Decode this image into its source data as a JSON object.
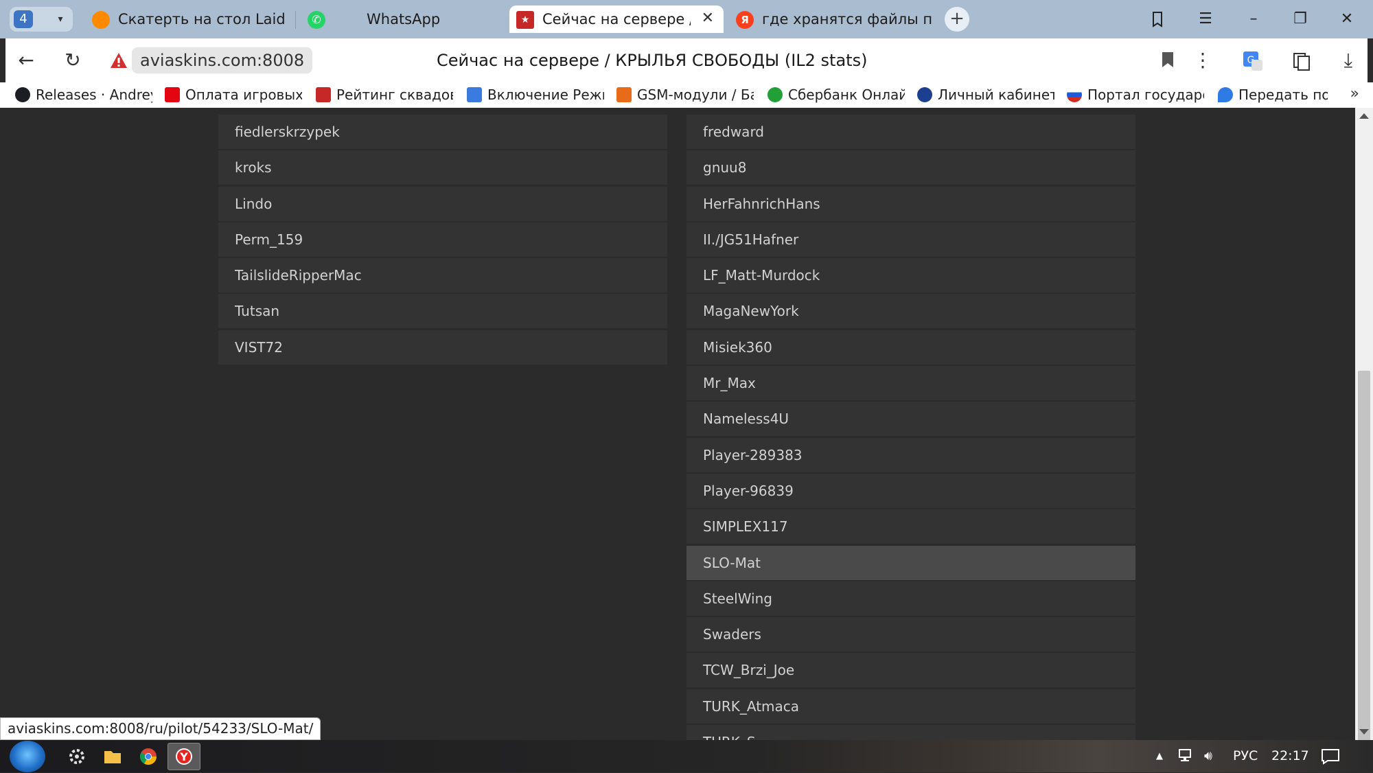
{
  "tabs": {
    "counter": "4",
    "items": [
      {
        "title": "Скатерть на стол Laid Tab",
        "icon": "ali-icon",
        "color": "#ff7a00"
      },
      {
        "title": "WhatsApp",
        "icon": "whatsapp-icon",
        "color": "#25d366"
      },
      {
        "title": "Сейчас на сервере / КР",
        "icon": "il2stats-icon",
        "color": "#c62828",
        "active": true
      },
      {
        "title": "где хранятся файлы прин",
        "icon": "yandex-icon",
        "color": "#fc3f1d"
      }
    ]
  },
  "address": {
    "host": "aviaskins.com:8008",
    "title": "Сейчас на сервере / КРЫЛЬЯ СВОБОДЫ (IL2 stats)"
  },
  "bookmarks": [
    {
      "label": "Releases · AndreyF",
      "icon": "github-icon"
    },
    {
      "label": "Оплата игровых к",
      "icon": "mts-icon"
    },
    {
      "label": "Рейтинг сквадов /",
      "icon": "il2stats-icon"
    },
    {
      "label": "Включение Режи",
      "icon": "page-icon"
    },
    {
      "label": "GSM-модули / Ба",
      "icon": "chart-icon"
    },
    {
      "label": "Сбербанк Онлайн",
      "icon": "sber-icon"
    },
    {
      "label": "Личный кабинет н",
      "icon": "nalog-icon"
    },
    {
      "label": "Портал государс",
      "icon": "gosuslugi-icon"
    },
    {
      "label": "Передать пок",
      "icon": "drop-icon"
    }
  ],
  "players_left": [
    "fiedlerskrzypek",
    "kroks",
    "Lindo",
    "Perm_159",
    "TailslideRipperMac",
    "Tutsan",
    "VIST72"
  ],
  "players_right": [
    "fredward",
    "gnuu8",
    "HerFahnrichHans",
    "II./JG51Hafner",
    "LF_Matt-Murdock",
    "MagaNewYork",
    "Misiek360",
    "Mr_Max",
    "Nameless4U",
    "Player-289383",
    "Player-96839",
    "SIMPLEX117",
    "SLO-Mat",
    "SteelWing",
    "Swaders",
    "TCW_Brzi_Joe",
    "TURK_Atmaca",
    "TURK_S"
  ],
  "hovered_player": "SLO-Mat",
  "status_url": "aviaskins.com:8008/ru/pilot/54233/SLO-Mat/",
  "taskbar": {
    "lang": "РУС",
    "time": "22:17"
  },
  "colors": {
    "page_bg": "#2b2b2b",
    "row_bg": "#333333",
    "row_hover": "#4a4a4a",
    "row_text": "#d2d2d2"
  }
}
